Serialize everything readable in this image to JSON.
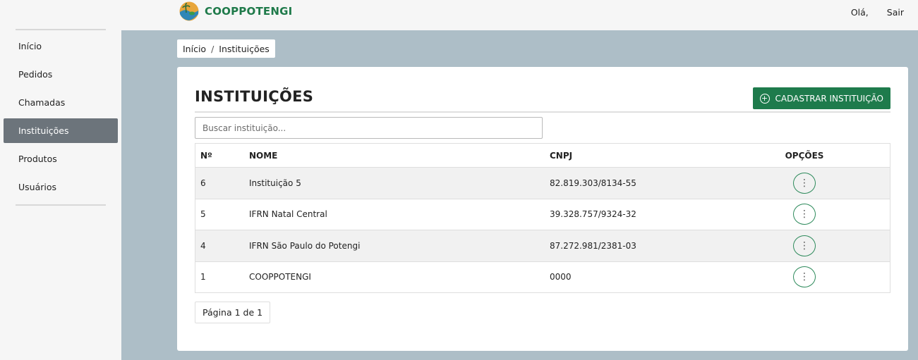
{
  "brand": {
    "name": "COOPPOTENGI",
    "icon": "cooppotengi-logo-icon",
    "color": "#1f7a4a"
  },
  "user_menu": {
    "greeting": "Olá,",
    "logout": "Sair"
  },
  "sidebar": {
    "items": [
      {
        "label": "Início",
        "active": false
      },
      {
        "label": "Pedidos",
        "active": false
      },
      {
        "label": "Chamadas",
        "active": false
      },
      {
        "label": "Instituições",
        "active": true
      },
      {
        "label": "Produtos",
        "active": false
      },
      {
        "label": "Usuários",
        "active": false
      }
    ]
  },
  "breadcrumb": {
    "home": "Início",
    "separator": "/",
    "current": "Instituições"
  },
  "page": {
    "title": "INSTITUIÇÕES",
    "add_button": "CADASTRAR INSTITUIÇÃO",
    "add_icon": "plus-circle-icon",
    "search_placeholder": "Buscar instituição..."
  },
  "table": {
    "headers": {
      "num": "Nº",
      "name": "NOME",
      "cnpj": "CNPJ",
      "options": "OPÇÕES"
    },
    "rows": [
      {
        "num": "6",
        "name": "Instituição 5",
        "cnpj": "82.819.303/8134-55"
      },
      {
        "num": "5",
        "name": "IFRN Natal Central",
        "cnpj": "39.328.757/9324-32"
      },
      {
        "num": "4",
        "name": "IFRN São Paulo do Potengi",
        "cnpj": "87.272.981/2381-03"
      },
      {
        "num": "1",
        "name": "COOPPOTENGI",
        "cnpj": "0000"
      }
    ],
    "options_icon": "more-vertical-icon"
  },
  "pagination": {
    "label": "Página 1 de 1"
  },
  "colors": {
    "accent": "#1e7b4c",
    "sidebar_active": "#6c747b",
    "main_background": "#adbec7"
  }
}
